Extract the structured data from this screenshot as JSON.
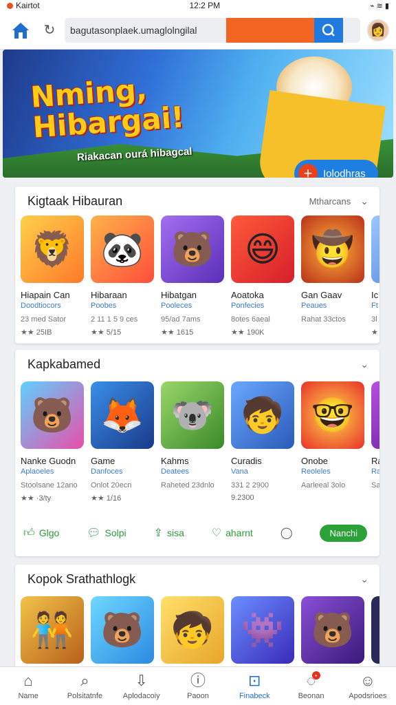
{
  "status_bar": {
    "carrier": "Kairtot",
    "time": "12:2 PM",
    "icons": "⌁ ≋ ▮"
  },
  "browser": {
    "url": "bagutasonplaek.umaglolngilal",
    "home_icon": "home-icon",
    "reload_icon": "reload-icon",
    "search_icon": "search-icon"
  },
  "banner": {
    "title_line1": "Nming,",
    "title_line2": "Hibargai!",
    "subtitle": "Riakacan ourá hibagcal",
    "cta_label": "Iolodhras"
  },
  "sections": [
    {
      "title": "Kigtaak Hibauran",
      "link": "Mtharcans",
      "apps": [
        {
          "name": "Hiapain Can",
          "category": "Doodtiocors",
          "meta": "23 med Sator",
          "rating": "★★ 25IB",
          "bg": "#ff9a3c",
          "emoji": "🦁"
        },
        {
          "name": "Hibaraan",
          "category": "Poobes",
          "meta": "2 11 1 5 9 ces",
          "rating": "★★ 5/15",
          "bg": "#ff7a3a",
          "emoji": "🐼"
        },
        {
          "name": "Hibatgan",
          "category": "Pooleces",
          "meta": "95/ad 7ams",
          "rating": "★★ 1615",
          "bg": "#7d4fd6",
          "emoji": "🐻"
        },
        {
          "name": "Aoatoka",
          "category": "Ponfecies",
          "meta": "8otes 6aeal",
          "rating": "★★ 190K",
          "bg": "#e9362a",
          "emoji": "😄"
        },
        {
          "name": "Gan Gaav",
          "category": "Peaues",
          "meta": "Rahat 33ctos",
          "rating": "",
          "bg": "#c4471f",
          "emoji": "🤠"
        },
        {
          "name": "Ic",
          "category": "Ft",
          "meta": "3l",
          "rating": "★",
          "bg": "#6fa5e8",
          "emoji": "🐼"
        }
      ]
    },
    {
      "title": "Kapkabamed",
      "link": "",
      "apps": [
        {
          "name": "Nanke Guodn",
          "category": "Aplaoeles",
          "meta": "Stoolsane 12ano",
          "rating": "★★ ·3/ty",
          "bg": "#e84fa8",
          "emoji": "🐻"
        },
        {
          "name": "Game",
          "category": "Danfoces",
          "meta": "Onlot 20ecn",
          "rating": "★★ 1/16",
          "bg": "#1f5fc8",
          "emoji": "🦊"
        },
        {
          "name": "Kahms",
          "category": "Deatees",
          "meta": "Raheted 23dnlo",
          "rating": "",
          "bg": "#7dc24a",
          "emoji": "🐨"
        },
        {
          "name": "Curadis",
          "category": "Vana",
          "meta": "331 2 2900",
          "rating": "9.2300",
          "bg": "#3a78d6",
          "emoji": "🧒"
        },
        {
          "name": "Onobe",
          "category": "Reoleles",
          "meta": "Aarleeal 3olo",
          "rating": "",
          "bg": "#f0a52a",
          "emoji": "🤓"
        },
        {
          "name": "Ra",
          "category": "Ra",
          "meta": "Sa",
          "rating": "",
          "bg": "#8b3fb8",
          "emoji": "🎮"
        }
      ],
      "actions": [
        {
          "label": "Glgo",
          "icon": "thumb-icon"
        },
        {
          "label": "Solpi",
          "icon": "chat-icon"
        },
        {
          "label": "sisa",
          "icon": "share-icon"
        },
        {
          "label": "aharnt",
          "icon": "heart-icon"
        }
      ],
      "action_button": "Nanchi"
    },
    {
      "title": "Kopok Srathathlogk",
      "link": "",
      "apps": [
        {
          "name": "",
          "category": "",
          "meta": "",
          "rating": "",
          "bg": "#f2a93a",
          "emoji": "🧑‍🤝‍🧑"
        },
        {
          "name": "",
          "category": "",
          "meta": "",
          "rating": "",
          "bg": "#3fb8e8",
          "emoji": "🐻"
        },
        {
          "name": "",
          "category": "",
          "meta": "",
          "rating": "",
          "bg": "#f3c34a",
          "emoji": "🧒"
        },
        {
          "name": "",
          "category": "",
          "meta": "",
          "rating": "",
          "bg": "#4a6fe0",
          "emoji": "👾"
        },
        {
          "name": "",
          "category": "",
          "meta": "",
          "rating": "",
          "bg": "#6a3fb0",
          "emoji": "🐻"
        },
        {
          "name": "",
          "category": "",
          "meta": "",
          "rating": "",
          "bg": "#2a2a5a",
          "emoji": ""
        }
      ]
    }
  ],
  "bottom_nav": [
    {
      "label": "Name",
      "icon": "home-icon",
      "glyph": "⌂"
    },
    {
      "label": "Polsitatnfe",
      "icon": "search-icon",
      "glyph": "⌕"
    },
    {
      "label": "Aplodacoiy",
      "icon": "download-icon",
      "glyph": "⇩"
    },
    {
      "label": "Paoon",
      "icon": "info-icon",
      "glyph": "ⓘ"
    },
    {
      "label": "Finabeck",
      "icon": "bookmark-icon",
      "glyph": "⊡"
    },
    {
      "label": "Beonan",
      "icon": "message-icon",
      "glyph": "◌",
      "badge": "•"
    },
    {
      "label": "Apodsrioes",
      "icon": "profile-icon",
      "glyph": "☺"
    }
  ],
  "colors": {
    "accent": "#1f6fd1",
    "green": "#2aa238",
    "orange": "#f26522"
  }
}
